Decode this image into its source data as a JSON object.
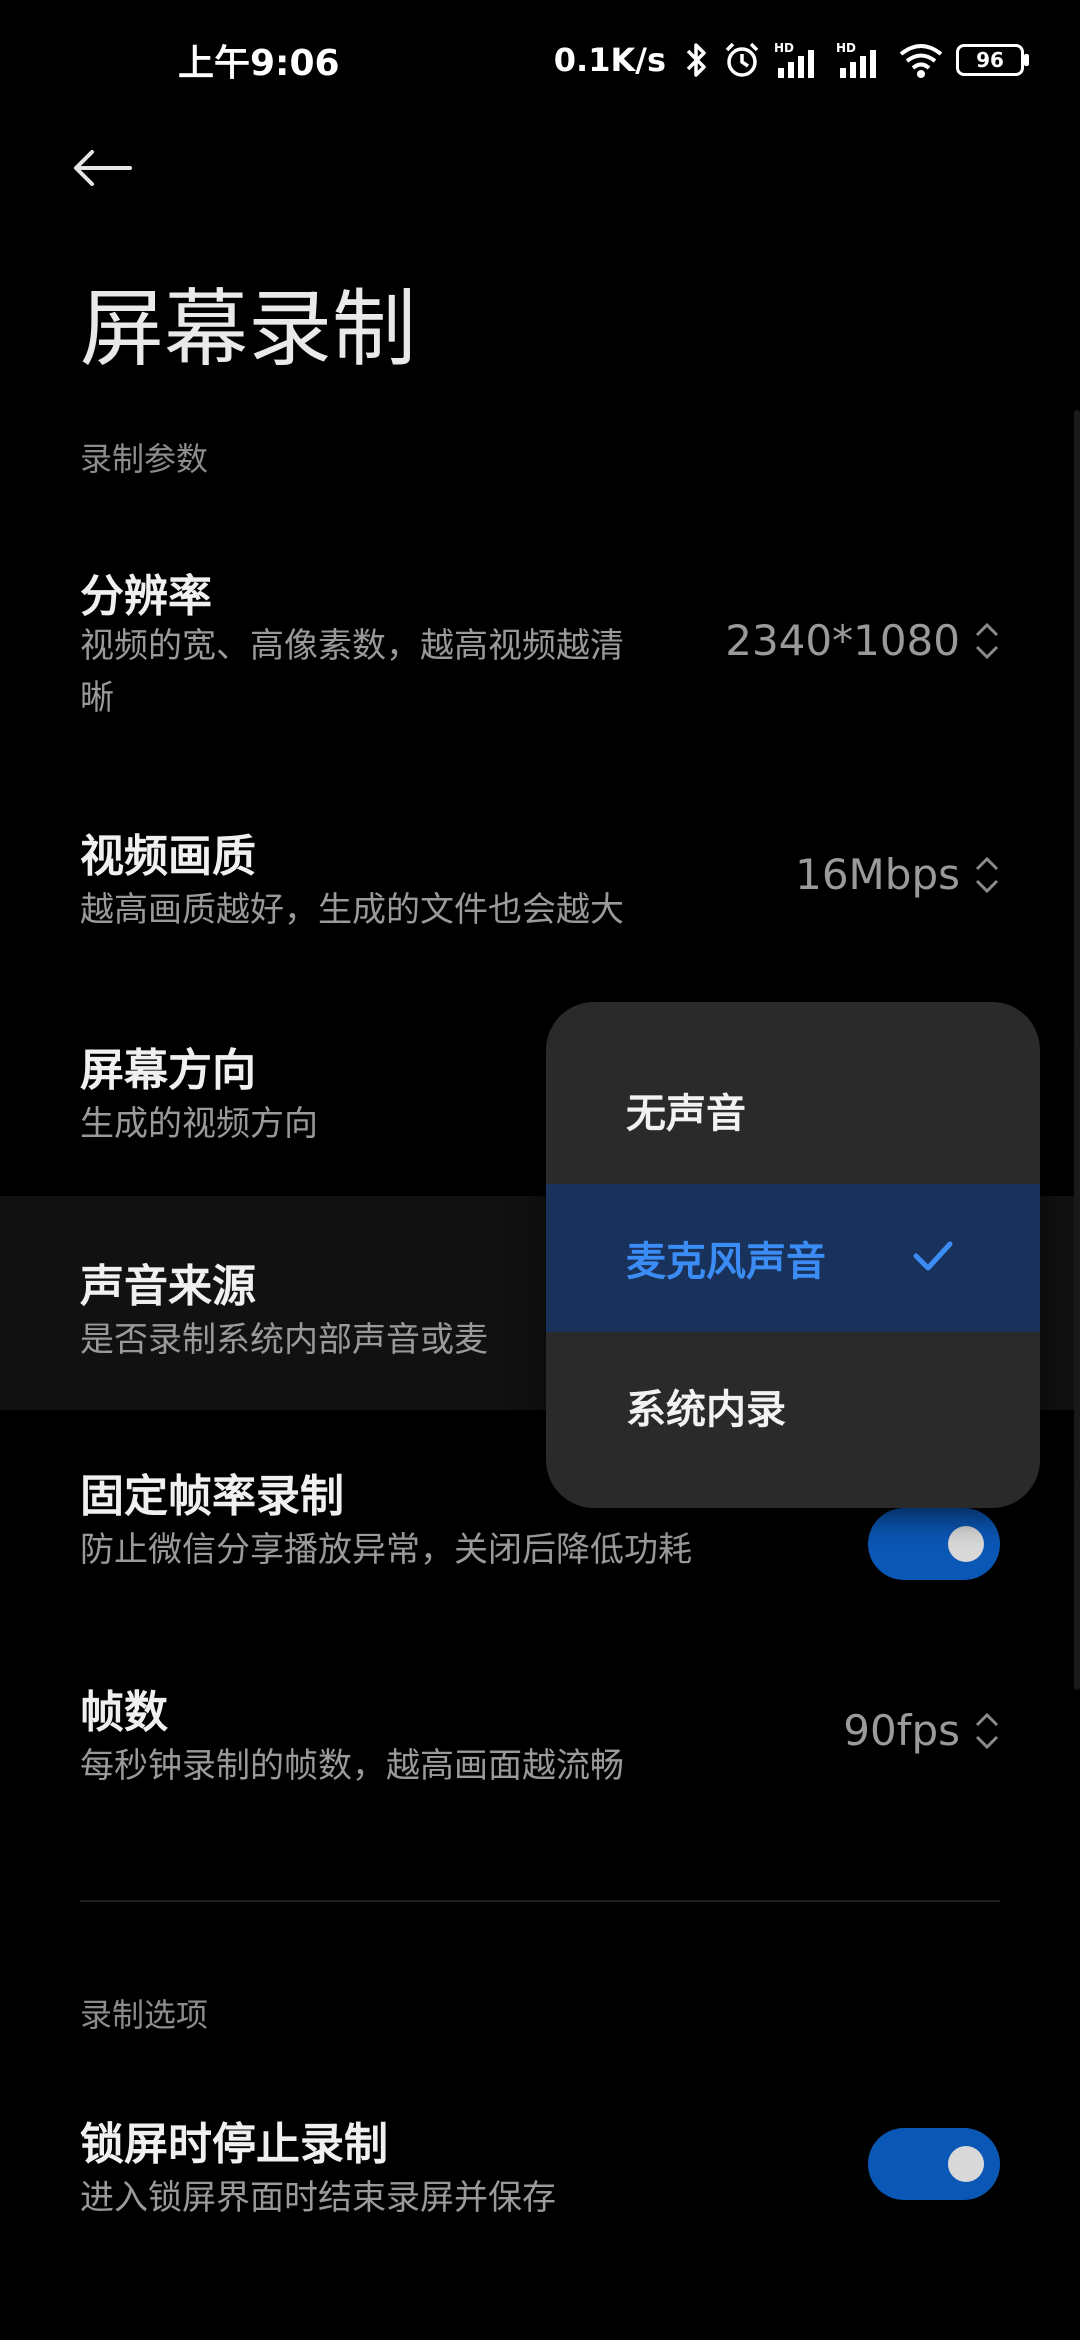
{
  "status_bar": {
    "time": "上午9:06",
    "speed": "0.1K/s",
    "battery": "96",
    "icons": [
      "bluetooth-icon",
      "alarm-icon",
      "signal-hd-icon",
      "signal-hd-icon",
      "wifi-icon",
      "battery-icon"
    ]
  },
  "header": {
    "title": "屏幕录制"
  },
  "sections": {
    "params": "录制参数",
    "options": "录制选项"
  },
  "rows": {
    "resolution": {
      "title": "分辨率",
      "desc_line1": "视频的宽、高像素数，越高视频越清",
      "desc_line2": "晰",
      "value": "2340*1080"
    },
    "quality": {
      "title": "视频画质",
      "desc": "越高画质越好，生成的文件也会越大",
      "value": "16Mbps"
    },
    "orientation": {
      "title": "屏幕方向",
      "desc": "生成的视频方向"
    },
    "audio": {
      "title": "声音来源",
      "desc": "是否录制系统内部声音或麦"
    },
    "fixed_fps": {
      "title": "固定帧率录制",
      "desc": "防止微信分享播放异常，关闭后降低功耗"
    },
    "fps": {
      "title": "帧数",
      "desc": "每秒钟录制的帧数，越高画面越流畅",
      "value": "90fps"
    },
    "lock_stop": {
      "title": "锁屏时停止录制",
      "desc": "进入锁屏界面时结束录屏并保存"
    }
  },
  "popup": {
    "options": [
      "无声音",
      "麦克风声音",
      "系统内录"
    ],
    "selected": "麦克风声音"
  },
  "colors": {
    "accent": "#3b8cf5",
    "toggle_on": "#0b57b6",
    "popup_bg": "#2a2a2a",
    "selected_bg": "#18325c"
  }
}
